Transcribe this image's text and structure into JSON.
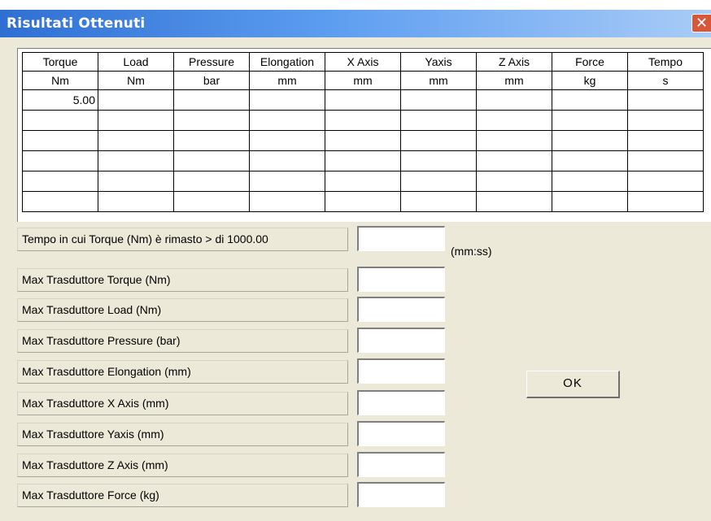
{
  "window": {
    "title": "Risultati Ottenuti",
    "close_glyph": "✕"
  },
  "grid": {
    "headers": [
      {
        "name": "Torque",
        "unit": "Nm"
      },
      {
        "name": "Load",
        "unit": "Nm"
      },
      {
        "name": "Pressure",
        "unit": "bar"
      },
      {
        "name": "Elongation",
        "unit": "mm"
      },
      {
        "name": "X Axis",
        "unit": "mm"
      },
      {
        "name": "Yaxis",
        "unit": "mm"
      },
      {
        "name": "Z Axis",
        "unit": "mm"
      },
      {
        "name": "Force",
        "unit": "kg"
      },
      {
        "name": "Tempo",
        "unit": "s"
      }
    ],
    "rows": [
      [
        "5.00",
        "",
        "",
        "",
        "",
        "",
        "",
        "",
        ""
      ],
      [
        "",
        "",
        "",
        "",
        "",
        "",
        "",
        "",
        ""
      ],
      [
        "",
        "",
        "",
        "",
        "",
        "",
        "",
        "",
        ""
      ],
      [
        "",
        "",
        "",
        "",
        "",
        "",
        "",
        "",
        ""
      ],
      [
        "",
        "",
        "",
        "",
        "",
        "",
        "",
        "",
        ""
      ],
      [
        "",
        "",
        "",
        "",
        "",
        "",
        "",
        "",
        ""
      ]
    ]
  },
  "results": [
    {
      "label": "Tempo in cui Torque (Nm) è rimasto > di 1000.00",
      "value": ""
    },
    {
      "label": "Max Trasduttore Torque (Nm)",
      "value": ""
    },
    {
      "label": "Max Trasduttore Load (Nm)",
      "value": ""
    },
    {
      "label": "Max Trasduttore Pressure (bar)",
      "value": ""
    },
    {
      "label": "Max Trasduttore Elongation (mm)",
      "value": ""
    },
    {
      "label": "Max Trasduttore X Axis (mm)",
      "value": ""
    },
    {
      "label": "Max Trasduttore Yaxis (mm)",
      "value": ""
    },
    {
      "label": "Max Trasduttore Z Axis (mm)",
      "value": ""
    },
    {
      "label": "Max Trasduttore Force (kg)",
      "value": ""
    }
  ],
  "time_unit": "(mm:ss)",
  "ok_label": "OK",
  "colors": {
    "titlebar_start": "#2f6fd3",
    "titlebar_end": "#a9ccf7",
    "dialog_bg": "#ece9d8",
    "close": "#d8573a"
  }
}
